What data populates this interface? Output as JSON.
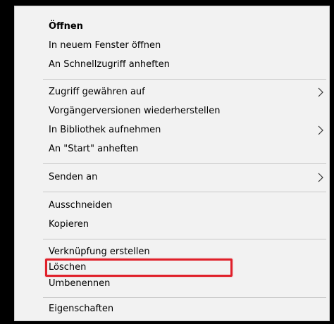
{
  "menu": {
    "items": [
      {
        "label": "Öffnen",
        "bold": true
      },
      {
        "label": "In neuem Fenster öffnen"
      },
      {
        "label": "An Schnellzugriff anheften"
      },
      {
        "label": "Zugriff gewähren auf",
        "submenu": true
      },
      {
        "label": "Vorgängerversionen wiederherstellen"
      },
      {
        "label": "In Bibliothek aufnehmen",
        "submenu": true
      },
      {
        "label": "An \"Start\" anheften"
      },
      {
        "label": "Senden an",
        "submenu": true
      },
      {
        "label": "Ausschneiden"
      },
      {
        "label": "Kopieren"
      },
      {
        "label": "Verknüpfung erstellen"
      },
      {
        "label": "Löschen",
        "highlighted": true
      },
      {
        "label": "Umbenennen"
      },
      {
        "label": "Eigenschaften"
      }
    ]
  },
  "colors": {
    "menu_bg": "#f2f2f2",
    "separator": "#c8c8c8",
    "highlight_border": "#e0202a"
  }
}
